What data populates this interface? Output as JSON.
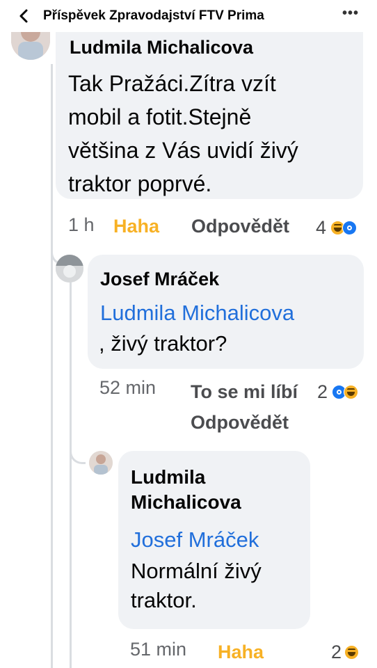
{
  "header": {
    "title": "Příspěvek Zpravodajství FTV Prima",
    "more_label": "•••"
  },
  "comments": [
    {
      "author": "Ludmila Michalicova",
      "lines": [
        "Tak Pražáci.Zítra vzít",
        "mobil a fotit.Stejně",
        "většina z Vás uvidí živý",
        "traktor poprvé."
      ],
      "time": "1 h",
      "reaction_label": "Haha",
      "reply_label": "Odpovědět",
      "reaction_count": "4",
      "reaction_icons": [
        "haha-icon",
        "like-icon"
      ]
    },
    {
      "author": "Josef Mráček",
      "mention": "Ludmila Michalicova",
      "text": ", živý traktor?",
      "time": "52 min",
      "reaction_label": "To se mi líbí",
      "reply_label": "Odpovědět",
      "reaction_count": "2",
      "reaction_icons": [
        "like-icon",
        "haha-icon"
      ]
    },
    {
      "author_lines": [
        "Ludmila",
        "Michalicova"
      ],
      "mention": "Josef Mráček",
      "lines": [
        "Normální živý",
        "traktor."
      ],
      "time": "51 min",
      "reaction_label": "Haha",
      "reaction_count": "2",
      "reaction_icons": [
        "haha-icon"
      ]
    }
  ],
  "colors": {
    "bubble": "#f0f2f5",
    "mention": "#216fdb",
    "haha": "#f7b125",
    "like": "#1877f2",
    "meta": "#65676b"
  }
}
